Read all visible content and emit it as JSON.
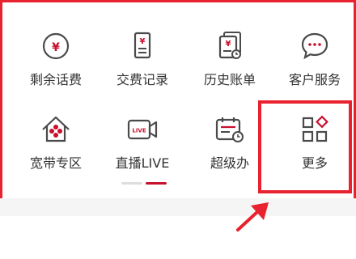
{
  "services": {
    "items": [
      {
        "label": "剩余话费",
        "icon": "yuan-coin-icon"
      },
      {
        "label": "交费记录",
        "icon": "receipt-icon"
      },
      {
        "label": "历史账单",
        "icon": "bill-history-icon"
      },
      {
        "label": "客户服务",
        "icon": "chat-bubble-icon"
      },
      {
        "label": "宽带专区",
        "icon": "home-network-icon"
      },
      {
        "label": "直播LIVE",
        "icon": "live-camera-icon"
      },
      {
        "label": "超级办",
        "icon": "calendar-clock-icon"
      },
      {
        "label": "更多",
        "icon": "grid-more-icon"
      }
    ]
  },
  "pager": {
    "pages": 2,
    "active": 2
  },
  "colors": {
    "accent": "#e8222e",
    "icon": "#5a5a5a",
    "brand": "#c8102e"
  }
}
